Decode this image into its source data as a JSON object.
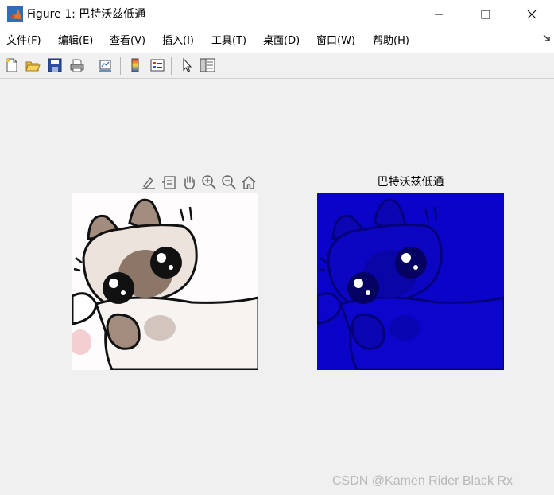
{
  "window": {
    "title": "Figure 1: 巴特沃兹低通"
  },
  "menu": [
    {
      "label": "文件(F)"
    },
    {
      "label": "编辑(E)"
    },
    {
      "label": "查看(V)"
    },
    {
      "label": "插入(I)"
    },
    {
      "label": "工具(T)"
    },
    {
      "label": "桌面(D)"
    },
    {
      "label": "窗口(W)"
    },
    {
      "label": "帮助(H)"
    }
  ],
  "toolbar": {
    "icons": [
      "new-figure-icon",
      "open-file-icon",
      "save-icon",
      "print-icon",
      "link-plot-icon",
      "colorbar-icon",
      "legend-icon",
      "edit-plot-cursor-icon",
      "property-inspector-icon"
    ]
  },
  "axes_toolbar": {
    "icons": [
      "brush-icon",
      "data-tips-icon",
      "pan-hand-icon",
      "zoom-in-icon",
      "zoom-out-icon",
      "home-icon"
    ]
  },
  "axes": {
    "right_title": "巴特沃兹低通"
  },
  "colors": {
    "filtered_image_blue": "#0a04c8",
    "matlab_gray": "#f0f0f0"
  },
  "watermark": "CSDN @Kamen Rider Black Rx"
}
